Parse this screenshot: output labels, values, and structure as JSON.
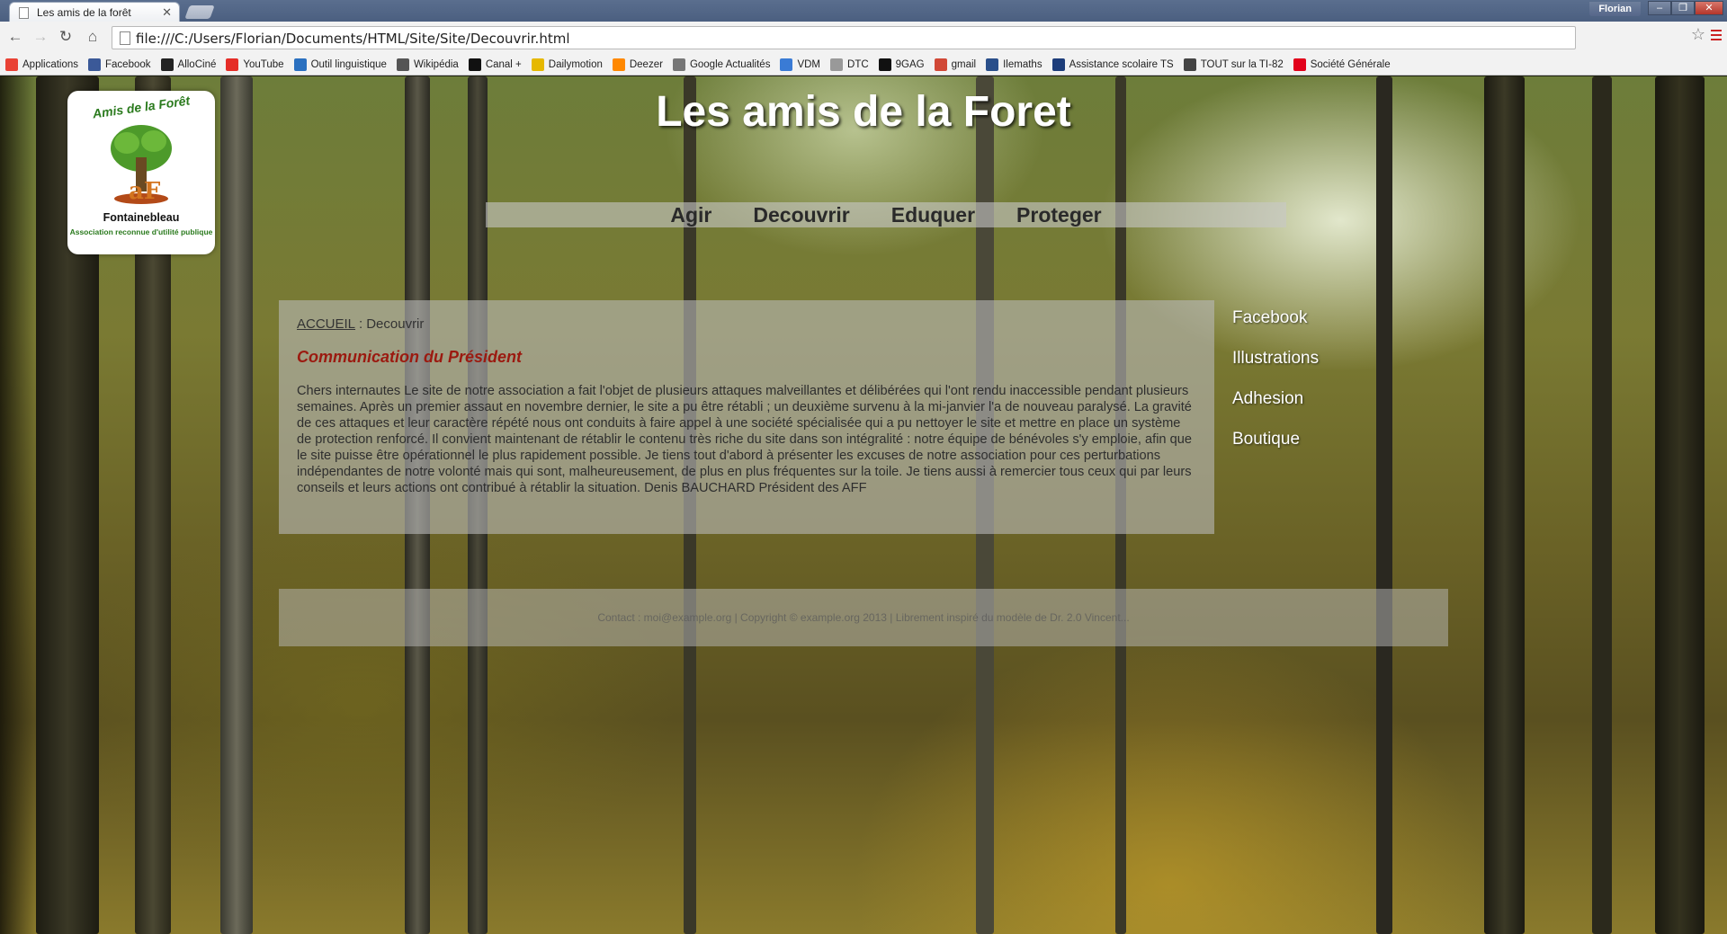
{
  "browser": {
    "tab_title": "Les amis de la forêt",
    "url": "file:///C:/Users/Florian/Documents/HTML/Site/Site/Decouvrir.html",
    "user": "Florian",
    "bookmarks": [
      {
        "label": "Applications",
        "icon": "apps-grid-icon",
        "color": "#e94235"
      },
      {
        "label": "Facebook",
        "icon": "facebook-icon",
        "color": "#3b5998"
      },
      {
        "label": "AlloCiné",
        "icon": "allocine-icon",
        "color": "#222222"
      },
      {
        "label": "YouTube",
        "icon": "youtube-icon",
        "color": "#e52d27"
      },
      {
        "label": "Outil linguistique",
        "icon": "globe-icon",
        "color": "#2a70c0"
      },
      {
        "label": "Wikipédia",
        "icon": "wikipedia-icon",
        "color": "#555555"
      },
      {
        "label": "Canal +",
        "icon": "plus-icon",
        "color": "#111111"
      },
      {
        "label": "Dailymotion",
        "icon": "dailymotion-icon",
        "color": "#e6b800"
      },
      {
        "label": "Deezer",
        "icon": "deezer-icon",
        "color": "#ff8800"
      },
      {
        "label": "Google Actualités",
        "icon": "news-icon",
        "color": "#777777"
      },
      {
        "label": "VDM",
        "icon": "vdm-icon",
        "color": "#3a7bd5"
      },
      {
        "label": "DTC",
        "icon": "page-icon",
        "color": "#999999"
      },
      {
        "label": "9GAG",
        "icon": "9gag-icon",
        "color": "#111111"
      },
      {
        "label": "gmail",
        "icon": "gmail-icon",
        "color": "#d14836"
      },
      {
        "label": "Ilemaths",
        "icon": "ilemaths-icon",
        "color": "#2a4f8a"
      },
      {
        "label": "Assistance scolaire TS",
        "icon": "asp-icon",
        "color": "#1d3d7a"
      },
      {
        "label": "TOUT sur la TI-82",
        "icon": "calculator-icon",
        "color": "#444444"
      },
      {
        "label": "Société Générale",
        "icon": "socgen-icon",
        "color": "#e2001a"
      }
    ]
  },
  "page": {
    "logo": {
      "arc_text": "Amis de la Forêt",
      "place": "Fontainebleau",
      "assoc": "Association reconnue d'utilité publique"
    },
    "title": "Les amis de la Foret",
    "nav": [
      "Agir",
      "Decouvrir",
      "Eduquer",
      "Proteger"
    ],
    "breadcrumb": {
      "home": "ACCUEIL",
      "sep": ":",
      "current": "Decouvrir"
    },
    "article_title": "Communication du Président",
    "article_body": "Chers internautes Le site de notre association a fait l'objet de plusieurs attaques malveillantes et délibérées qui l'ont rendu inaccessible pendant plusieurs semaines. Après un premier assaut en novembre dernier, le site a pu être rétabli ; un deuxième survenu à la mi-janvier l'a de nouveau paralysé. La gravité de ces attaques et leur caractère répété nous ont conduits à faire appel à une société spécialisée qui a pu nettoyer le site et mettre en place un système de protection renforcé. Il convient maintenant de rétablir le contenu très riche du site dans son intégralité : notre équipe de bénévoles s'y emploie, afin que le site puisse être opérationnel le plus rapidement possible. Je tiens tout d'abord à présenter les excuses de notre association pour ces perturbations indépendantes de notre volonté mais qui sont, malheureusement, de plus en plus fréquentes sur la toile. Je tiens aussi à remercier tous ceux qui par leurs conseils et leurs actions ont contribué à rétablir la situation. Denis BAUCHARD Président des AFF",
    "side_links": [
      "Facebook",
      "Illustrations",
      "Adhesion",
      "Boutique"
    ],
    "footer": "Contact : moi@example.org  |  Copyright © example.org 2013  |  Librement inspiré du modèle de Dr. 2.0 Vincent..."
  }
}
